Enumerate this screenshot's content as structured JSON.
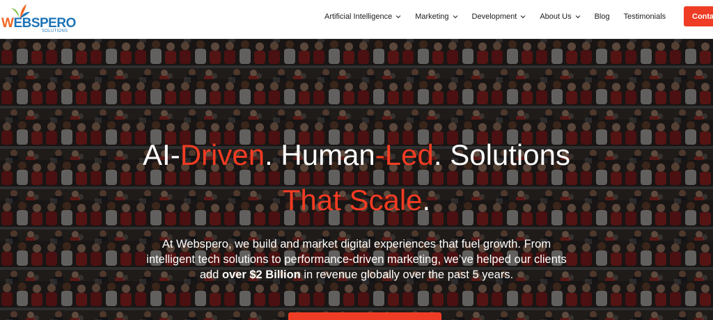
{
  "brand": {
    "logo_first": "W",
    "logo_rest": "EBSPERO",
    "logo_sub": "SOLUTIONS",
    "colors": {
      "orange": "#f26522",
      "blue": "#1d74b7",
      "leaf_green": "#7cc242"
    }
  },
  "nav": {
    "items": [
      {
        "label": "Artificial Intelligence",
        "dropdown": true
      },
      {
        "label": "Marketing",
        "dropdown": true
      },
      {
        "label": "Development",
        "dropdown": true
      },
      {
        "label": "About Us",
        "dropdown": true
      },
      {
        "label": "Blog",
        "dropdown": false
      },
      {
        "label": "Testimonials",
        "dropdown": false
      }
    ],
    "contact_label": "Conta"
  },
  "hero": {
    "headline": {
      "p1": "AI-",
      "p2": "Driven",
      "p3": ". Human",
      "p4": "-Led",
      "p5": ". Solutions",
      "p6": "That Scale",
      "p7": "."
    },
    "paragraph": {
      "line1": "At Webspero, we build and market digital experiences that fuel growth. From",
      "line2": "intelligent tech solutions to performance-driven marketing, we’ve helped our clients",
      "line3_pre": "add ",
      "line3_bold": "over $2 Billion",
      "line3_post": " in revenue globally over the past 5 years."
    },
    "accent_color": "#f23b22"
  }
}
